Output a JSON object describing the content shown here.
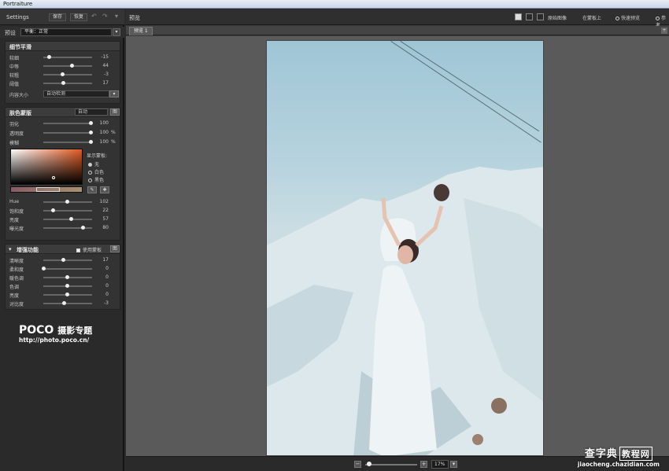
{
  "window": {
    "title": "Portraiture"
  },
  "left": {
    "toolbar": {
      "title": "Settings",
      "btn1": "保存",
      "btn2": "恢复"
    },
    "preset": {
      "label": "预设",
      "value": "平衡：正常"
    },
    "detail": {
      "title": "细节平滑",
      "rows": [
        {
          "label": "较细",
          "value": "-15"
        },
        {
          "label": "中等",
          "value": "44"
        },
        {
          "label": "较粗",
          "value": "-3"
        },
        {
          "label": "阈值",
          "value": "17"
        }
      ],
      "size_label": "内容大小",
      "size_value": "自动检测"
    },
    "mask": {
      "title": "肤色蒙版",
      "select": "自动",
      "btn": "图",
      "rows": [
        {
          "label": "羽化",
          "value": "100",
          "unit": ""
        },
        {
          "label": "透明度",
          "value": "100",
          "unit": "%"
        },
        {
          "label": "模糊",
          "value": "100",
          "unit": "%"
        }
      ],
      "display_label": "显示蒙板:",
      "radios": [
        "无",
        "白色",
        "黑色"
      ],
      "hsl": [
        {
          "label": "Hue",
          "value": "102"
        },
        {
          "label": "饱和度",
          "value": "22"
        },
        {
          "label": "亮度",
          "value": "57"
        },
        {
          "label": "曝光度",
          "value": "80"
        }
      ]
    },
    "enhance": {
      "title": "增强功能",
      "checkbox_label": "使用蒙板",
      "btn": "图",
      "rows": [
        {
          "label": "清晰度",
          "value": "17"
        },
        {
          "label": "柔和度",
          "value": "0"
        },
        {
          "label": "暖色调",
          "value": "0"
        },
        {
          "label": "色调",
          "value": "0"
        },
        {
          "label": "亮度",
          "value": "0"
        },
        {
          "label": "对比度",
          "value": "-3"
        }
      ]
    },
    "watermark": {
      "brand": "POCO",
      "brand_cn": "摄影专题",
      "url": "http://photo.poco.cn/"
    }
  },
  "right": {
    "label": "预览",
    "options": [
      "原始图像",
      "在蒙板上",
      "快速预览",
      "参考"
    ],
    "tab": "预览 1",
    "zoom": "17%"
  },
  "site_watermark": {
    "name": "查字典",
    "box": "教程网",
    "url": "jiaocheng.chazidian.com"
  }
}
